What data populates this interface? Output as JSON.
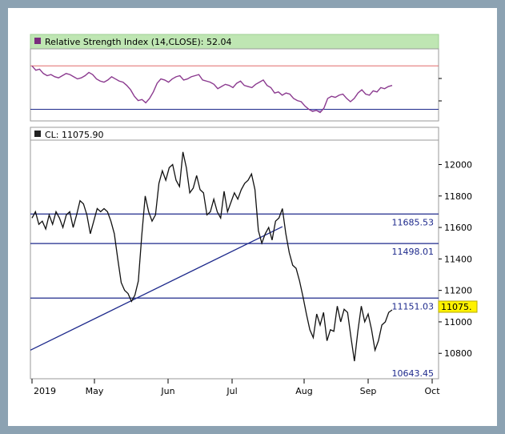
{
  "rsi_panel": {
    "title": "Relative Strength Index (14,CLOSE): 52.04",
    "line_color": "#8b3a8f",
    "overbought_color": "#e06a6a",
    "oversold_color": "#1e2a8c",
    "header_bg": "#bfe6b3"
  },
  "price_panel": {
    "title": "CL: 11075.90",
    "last_label": "11075.",
    "level_color": "#1e2a8c"
  },
  "chart_data": [
    {
      "type": "line",
      "title": "Relative Strength Index (14,CLOSE): 52.04",
      "ylim": [
        20,
        85
      ],
      "reference_lines": [
        70,
        30
      ],
      "series": [
        {
          "values": [
            70,
            66,
            67,
            63,
            61,
            62,
            60,
            59,
            61,
            63,
            62,
            60,
            58,
            59,
            61,
            64,
            62,
            58,
            56,
            55,
            57,
            60,
            58,
            56,
            55,
            52,
            48,
            42,
            38,
            39,
            36,
            40,
            46,
            54,
            58,
            57,
            55,
            58,
            60,
            61,
            57,
            58,
            60,
            61,
            62,
            57,
            56,
            55,
            53,
            49,
            51,
            53,
            52,
            50,
            54,
            56,
            52,
            51,
            50,
            53,
            55,
            57,
            52,
            50,
            45,
            46,
            43,
            45,
            44,
            40,
            38,
            37,
            33,
            30,
            28,
            29,
            27,
            31,
            40,
            42,
            41,
            43,
            44,
            40,
            37,
            40,
            45,
            48,
            44,
            43,
            47,
            46,
            50,
            49,
            51,
            52
          ]
        }
      ]
    },
    {
      "type": "line",
      "title": "CL: 11075.90",
      "ylim": [
        10643.45,
        12150
      ],
      "x_tick_labels": [
        "2019",
        "May",
        "Jun",
        "Jul",
        "Aug",
        "Sep",
        "Oct"
      ],
      "y_tick_labels": [
        "12000",
        "11800",
        "11600",
        "11400",
        "11200",
        "11000",
        "10800"
      ],
      "y_ticks": [
        12000,
        11800,
        11600,
        11400,
        11200,
        11000,
        10800
      ],
      "series": [
        {
          "values": [
            11660,
            11700,
            11620,
            11640,
            11590,
            11680,
            11620,
            11700,
            11660,
            11600,
            11680,
            11700,
            11600,
            11680,
            11770,
            11750,
            11680,
            11560,
            11640,
            11720,
            11700,
            11720,
            11700,
            11640,
            11560,
            11400,
            11250,
            11200,
            11180,
            11130,
            11170,
            11260,
            11550,
            11800,
            11700,
            11640,
            11680,
            11880,
            11960,
            11900,
            11980,
            12000,
            11900,
            11860,
            12080,
            11980,
            11820,
            11850,
            11930,
            11840,
            11820,
            11680,
            11700,
            11780,
            11700,
            11660,
            11830,
            11700,
            11760,
            11820,
            11780,
            11840,
            11880,
            11900,
            11940,
            11840,
            11580,
            11500,
            11560,
            11600,
            11520,
            11640,
            11660,
            11720,
            11560,
            11440,
            11360,
            11340,
            11260,
            11160,
            11050,
            10950,
            10900,
            11050,
            10980,
            11060,
            10880,
            10950,
            10940,
            11100,
            11000,
            11080,
            11060,
            10900,
            10750,
            10940,
            11100,
            11000,
            11050,
            10950,
            10820,
            10880,
            10980,
            11000,
            11060,
            11076
          ]
        }
      ],
      "horizontal_levels": [
        {
          "value": 11685.53,
          "label": "11685.53"
        },
        {
          "value": 11498.01,
          "label": "11498.01"
        },
        {
          "value": 11151.03,
          "label": "11151.03"
        },
        {
          "value": 10643.45,
          "label": "10643.45"
        }
      ],
      "trendline": {
        "from": [
          0,
          10820
        ],
        "to": [
          73,
          11605
        ]
      }
    }
  ]
}
